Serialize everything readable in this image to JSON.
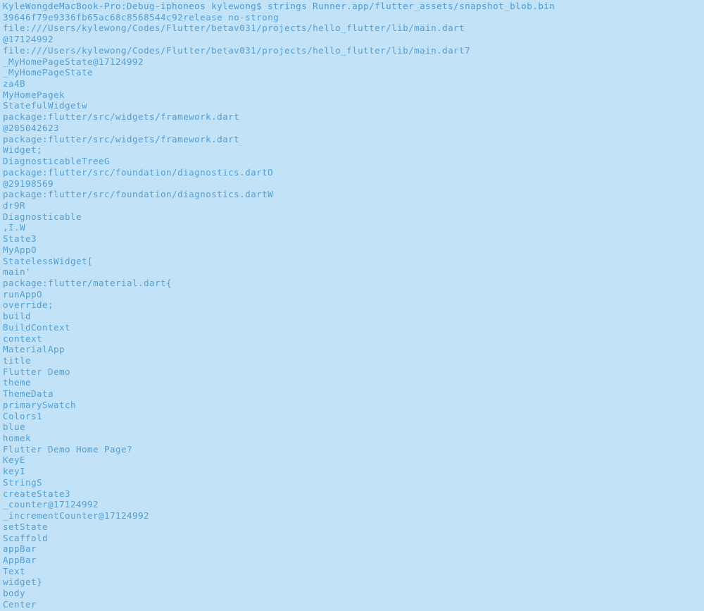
{
  "terminal": {
    "background_color": "#c2e2f7",
    "text_color": "#4fa0d8",
    "prompt_line": "KyleWongdeMacBook-Pro:Debug-iphoneos kylewong$ strings Runner.app/flutter_assets/snapshot_blob.bin",
    "lines": [
      "KyleWongdeMacBook-Pro:Debug-iphoneos kylewong$ strings Runner.app/flutter_assets/snapshot_blob.bin",
      "39646f79e9336fb65ac68c8568544c92release no-strong",
      "file:///Users/kylewong/Codes/Flutter/betav031/projects/hello_flutter/lib/main.dart",
      "@17124992",
      "file:///Users/kylewong/Codes/Flutter/betav031/projects/hello_flutter/lib/main.dart7",
      "_MyHomePageState@17124992",
      "_MyHomePageState",
      "za4B",
      "MyHomePagek",
      "StatefulWidgetw",
      "package:flutter/src/widgets/framework.dart",
      "@205042623",
      "package:flutter/src/widgets/framework.dart",
      "Widget;",
      "DiagnosticableTreeG",
      "package:flutter/src/foundation/diagnostics.dartO",
      "@29198569",
      "package:flutter/src/foundation/diagnostics.dartW",
      "dr9R",
      "Diagnosticable",
      ",I.W",
      "State3",
      "MyAppO",
      "StatelessWidget[",
      "main'",
      "package:flutter/material.dart{",
      "runAppO",
      "override;",
      "build",
      "BuildContext",
      "context",
      "MaterialApp",
      "title",
      "Flutter Demo",
      "theme",
      "ThemeData",
      "primarySwatch",
      "Colors1",
      "blue",
      "homek",
      "Flutter Demo Home Page?",
      "KeyE",
      "keyI",
      "StringS",
      "createState3",
      "_counter@17124992",
      "_incrementCounter@17124992",
      "setState",
      "Scaffold",
      "appBar",
      "AppBar",
      "Text",
      "widget}",
      "body",
      "Center"
    ]
  }
}
